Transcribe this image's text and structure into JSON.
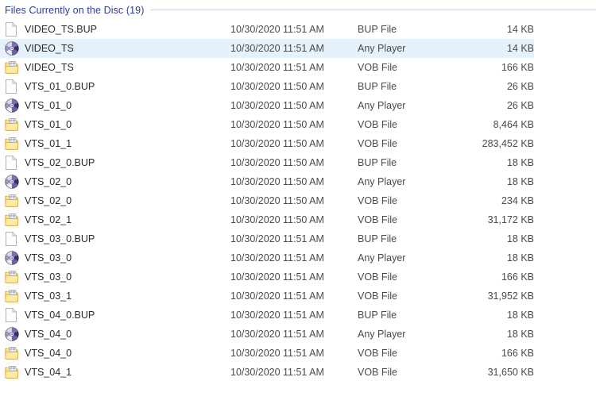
{
  "group": {
    "header_label": "Files Currently on the Disc (19)",
    "count": 19,
    "header_text_color": "#2f3a9e",
    "rule_color": "#cfd4e4"
  },
  "selection": {
    "selected_row_index": 1,
    "highlight_color": "#e5f2fb"
  },
  "icons": {
    "bup": "blank-document-icon",
    "any_player": "disc-media-icon",
    "vob": "vob-media-file-icon"
  },
  "files": [
    {
      "name": "VIDEO_TS.BUP",
      "date": "10/30/2020 11:51 AM",
      "type": "BUP File",
      "size": "14 KB",
      "icon": "bup"
    },
    {
      "name": "VIDEO_TS",
      "date": "10/30/2020 11:51 AM",
      "type": "Any Player",
      "size": "14 KB",
      "icon": "any_player"
    },
    {
      "name": "VIDEO_TS",
      "date": "10/30/2020 11:51 AM",
      "type": "VOB File",
      "size": "166 KB",
      "icon": "vob"
    },
    {
      "name": "VTS_01_0.BUP",
      "date": "10/30/2020 11:50 AM",
      "type": "BUP File",
      "size": "26 KB",
      "icon": "bup"
    },
    {
      "name": "VTS_01_0",
      "date": "10/30/2020 11:50 AM",
      "type": "Any Player",
      "size": "26 KB",
      "icon": "any_player"
    },
    {
      "name": "VTS_01_0",
      "date": "10/30/2020 11:50 AM",
      "type": "VOB File",
      "size": "8,464 KB",
      "icon": "vob"
    },
    {
      "name": "VTS_01_1",
      "date": "10/30/2020 11:50 AM",
      "type": "VOB File",
      "size": "283,452 KB",
      "icon": "vob"
    },
    {
      "name": "VTS_02_0.BUP",
      "date": "10/30/2020 11:50 AM",
      "type": "BUP File",
      "size": "18 KB",
      "icon": "bup"
    },
    {
      "name": "VTS_02_0",
      "date": "10/30/2020 11:50 AM",
      "type": "Any Player",
      "size": "18 KB",
      "icon": "any_player"
    },
    {
      "name": "VTS_02_0",
      "date": "10/30/2020 11:50 AM",
      "type": "VOB File",
      "size": "234 KB",
      "icon": "vob"
    },
    {
      "name": "VTS_02_1",
      "date": "10/30/2020 11:50 AM",
      "type": "VOB File",
      "size": "31,172 KB",
      "icon": "vob"
    },
    {
      "name": "VTS_03_0.BUP",
      "date": "10/30/2020 11:51 AM",
      "type": "BUP File",
      "size": "18 KB",
      "icon": "bup"
    },
    {
      "name": "VTS_03_0",
      "date": "10/30/2020 11:51 AM",
      "type": "Any Player",
      "size": "18 KB",
      "icon": "any_player"
    },
    {
      "name": "VTS_03_0",
      "date": "10/30/2020 11:51 AM",
      "type": "VOB File",
      "size": "166 KB",
      "icon": "vob"
    },
    {
      "name": "VTS_03_1",
      "date": "10/30/2020 11:51 AM",
      "type": "VOB File",
      "size": "31,952 KB",
      "icon": "vob"
    },
    {
      "name": "VTS_04_0.BUP",
      "date": "10/30/2020 11:51 AM",
      "type": "BUP File",
      "size": "18 KB",
      "icon": "bup"
    },
    {
      "name": "VTS_04_0",
      "date": "10/30/2020 11:51 AM",
      "type": "Any Player",
      "size": "18 KB",
      "icon": "any_player"
    },
    {
      "name": "VTS_04_0",
      "date": "10/30/2020 11:51 AM",
      "type": "VOB File",
      "size": "166 KB",
      "icon": "vob"
    },
    {
      "name": "VTS_04_1",
      "date": "10/30/2020 11:51 AM",
      "type": "VOB File",
      "size": "31,650 KB",
      "icon": "vob"
    }
  ]
}
